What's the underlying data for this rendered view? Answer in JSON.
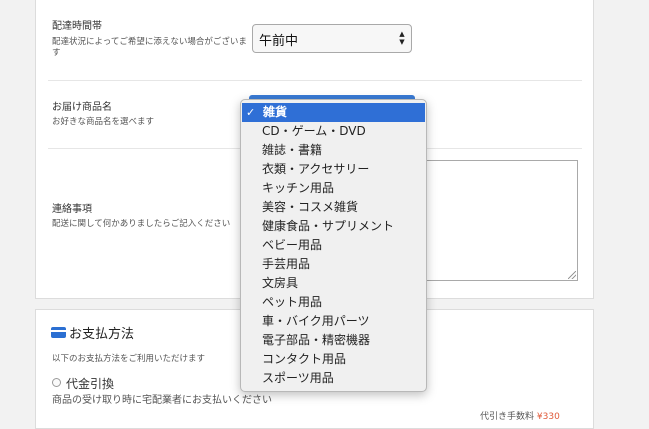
{
  "delivery_time": {
    "label": "配達時間帯",
    "note": "配達状況によってご希望に添えない場合がございます",
    "value": "午前中"
  },
  "product_name": {
    "label": "お届け商品名",
    "note": "お好きな商品名を選べます"
  },
  "dropdown": {
    "options": [
      {
        "label": "雑貨",
        "selected": true
      },
      {
        "label": "CD・ゲーム・DVD"
      },
      {
        "label": "雑誌・書籍"
      },
      {
        "label": "衣類・アクセサリー"
      },
      {
        "label": "キッチン用品"
      },
      {
        "label": "美容・コスメ雑貨"
      },
      {
        "label": "健康食品・サプリメント"
      },
      {
        "label": "ベビー用品"
      },
      {
        "label": "手芸用品"
      },
      {
        "label": "文房具"
      },
      {
        "label": "ペット用品"
      },
      {
        "label": "車・バイク用パーツ"
      },
      {
        "label": "電子部品・精密機器"
      },
      {
        "label": "コンタクト用品"
      },
      {
        "label": "スポーツ用品"
      }
    ]
  },
  "contact": {
    "label": "連絡事項",
    "note": "配送に関して何かありましたらご記入ください"
  },
  "payment": {
    "title": "お支払方法",
    "intro": "以下のお支払方法をご利用いただけます",
    "cod_label": "代金引換",
    "cod_note": "商品の受け取り時に宅配業者にお支払いください",
    "fee_partial": "代引き手数料",
    "fee_value": "¥330"
  },
  "colors": {
    "accent": "#2f6fd6",
    "fee": "#e05a3a"
  }
}
